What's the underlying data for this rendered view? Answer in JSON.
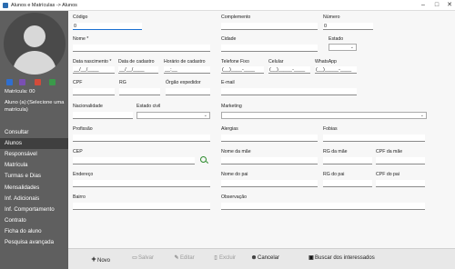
{
  "window": {
    "title": "Alunos e Matrículas  -> Alunos"
  },
  "sidebar": {
    "matricula_label": "Matrícula: 00",
    "aluno_label": "Aluno (a):(Selecione uma matrícula)",
    "menu": [
      "Consultar",
      "Alunos",
      "Responsável",
      "Matrícula",
      "Turmas e Dias",
      "Mensalidades",
      "Inf. Adicionais",
      "Inf. Comportamento",
      "Contrato",
      "Ficha do aluno",
      "Pesquisa avançada"
    ],
    "active": "Alunos",
    "action_colors": [
      "#2f6fd0",
      "#7a4fb3",
      "#d24b3a",
      "#3a9a4a"
    ]
  },
  "form": {
    "codigo": {
      "label": "Código",
      "value": "0"
    },
    "complemento": {
      "label": "Complemento",
      "value": ""
    },
    "numero": {
      "label": "Número",
      "value": "0"
    },
    "nome": {
      "label": "Nome *",
      "value": ""
    },
    "cidade": {
      "label": "Cidade",
      "value": ""
    },
    "estado": {
      "label": "Estado",
      "value": ""
    },
    "data_nascimento": {
      "label": "Data nascimento *",
      "value": "__/__/____"
    },
    "data_cadastro": {
      "label": "Data de cadastro",
      "value": "__/__/____"
    },
    "horario_cadastro": {
      "label": "Horário de cadastro",
      "value": "__:__"
    },
    "telefone_fixo": {
      "label": "Telefone Fixo",
      "value": "(__)____-____"
    },
    "celular": {
      "label": "Celular",
      "value": "(__)_____-____"
    },
    "whatsapp": {
      "label": "WhatsApp",
      "value": "(__)_____-____"
    },
    "cpf": {
      "label": "CPF",
      "value": ""
    },
    "rg": {
      "label": "RG",
      "value": ""
    },
    "orgao_expedidor": {
      "label": "Órgão expedidor",
      "value": ""
    },
    "email": {
      "label": "E-mail",
      "value": ""
    },
    "nacionalidade": {
      "label": "Nacionalidade",
      "value": ""
    },
    "estado_civil": {
      "label": "Estado civil",
      "value": ""
    },
    "marketing": {
      "label": "Marketing",
      "value": ""
    },
    "profissao": {
      "label": "Profissão",
      "value": ""
    },
    "alergias": {
      "label": "Alergias",
      "value": ""
    },
    "fobias": {
      "label": "Fobias",
      "value": ""
    },
    "cep": {
      "label": "CEP",
      "value": ""
    },
    "nome_mae": {
      "label": "Nome da mãe",
      "value": ""
    },
    "rg_mae": {
      "label": "RG da mãe",
      "value": ""
    },
    "cpf_mae": {
      "label": "CPF da mãe",
      "value": ""
    },
    "endereco": {
      "label": "Endereço",
      "value": ""
    },
    "nome_pai": {
      "label": "Nome do pai",
      "value": ""
    },
    "rg_pai": {
      "label": "RG do pai",
      "value": ""
    },
    "cpf_pai": {
      "label": "CPF do pai",
      "value": ""
    },
    "bairro": {
      "label": "Bairro",
      "value": ""
    },
    "observacao": {
      "label": "Observação",
      "value": ""
    }
  },
  "toolbar": {
    "novo": "Novo",
    "salvar": "Salvar",
    "editar": "Editar",
    "excluir": "Excluir",
    "cancelar": "Cancelar",
    "buscar": "Buscar dos interessados"
  }
}
